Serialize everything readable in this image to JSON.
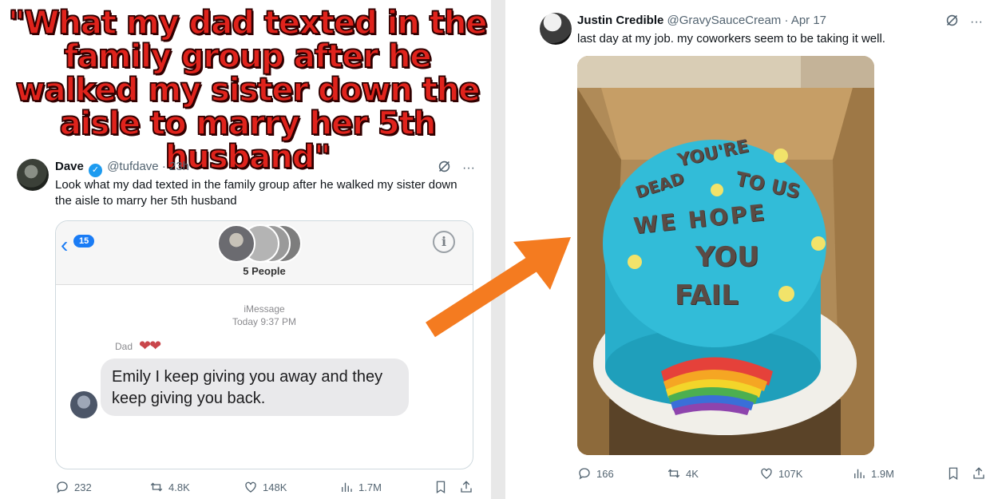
{
  "headline": "\"What my dad texted in the family group after he walked my sister down the aisle to marry her 5th husband\"",
  "left_tweet": {
    "name": "Dave",
    "handle": "@tufdave",
    "time": "· 23h",
    "text": "Look what my dad texted in the family group after he walked my sister down the aisle to marry her 5th husband",
    "more_icon": "···",
    "replies": "232",
    "retweets": "4.8K",
    "likes": "148K",
    "views": "1.7M"
  },
  "imessage": {
    "back_count": "15",
    "group_label": "5 People",
    "service": "iMessage",
    "timestamp": "Today 9:37 PM",
    "sender": "Dad",
    "hearts": "❤❤",
    "message": "Emily I keep giving you away and they keep giving you back.",
    "info_icon": "i"
  },
  "right_tweet": {
    "name": "Justin Credible",
    "handle": "@GravySauceCream",
    "time": "· Apr 17",
    "text": "last day at my job. my coworkers seem to be taking it well.",
    "more_icon": "···",
    "replies": "166",
    "retweets": "4K",
    "likes": "107K",
    "views": "1.9M"
  },
  "cake": {
    "line1": "YOU'RE",
    "line2a": "DEAD",
    "line2b": "TO US",
    "line3": "WE HOPE",
    "line4": "YOU",
    "line5": "FAIL"
  },
  "colors": {
    "headline_red": "#e0231c",
    "arrow_orange": "#f47b20",
    "imessage_blue": "#1a7cf5",
    "cake_blue": "#29b3cf"
  }
}
